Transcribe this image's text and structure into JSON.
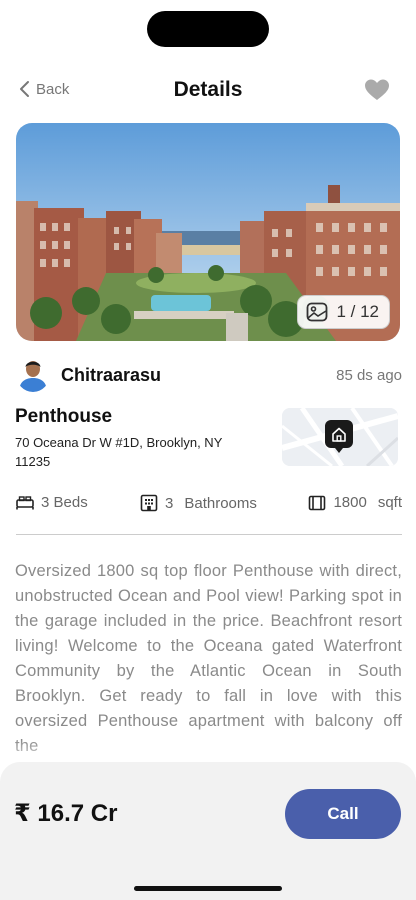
{
  "header": {
    "back_label": "Back",
    "title": "Details"
  },
  "gallery": {
    "counter": "1 / 12"
  },
  "owner": {
    "name": "Chitraarasu",
    "posted": "85 ds ago"
  },
  "property": {
    "title": "Penthouse",
    "address": "70 Oceana Dr W #1D, Brooklyn, NY 11235"
  },
  "specs": {
    "beds": "3 Beds",
    "baths_count": "3",
    "baths_label": "Bathrooms",
    "area_value": "1800",
    "area_unit": "sqft"
  },
  "description": "Oversized 1800 sq top floor Penthouse with direct, unobstructed Ocean and Pool view! Parking spot in the garage included in the price. Beachfront resort living! Welcome to the Oceana gated Waterfront Community by the Atlantic Ocean in South Brooklyn. Get ready to fall in love with this oversized Penthouse apartment with balcony off the",
  "footer": {
    "price": "₹ 16.7 Cr",
    "call_label": "Call"
  },
  "icons": {
    "back": "chevron-left-icon",
    "favorite": "heart-icon",
    "gallery": "image-icon",
    "map_pin": "home-pin-icon",
    "beds": "bed-icon",
    "baths": "building-icon",
    "area": "area-icon"
  },
  "colors": {
    "accent": "#4a5fab",
    "muted_text": "#8a8a8a"
  }
}
